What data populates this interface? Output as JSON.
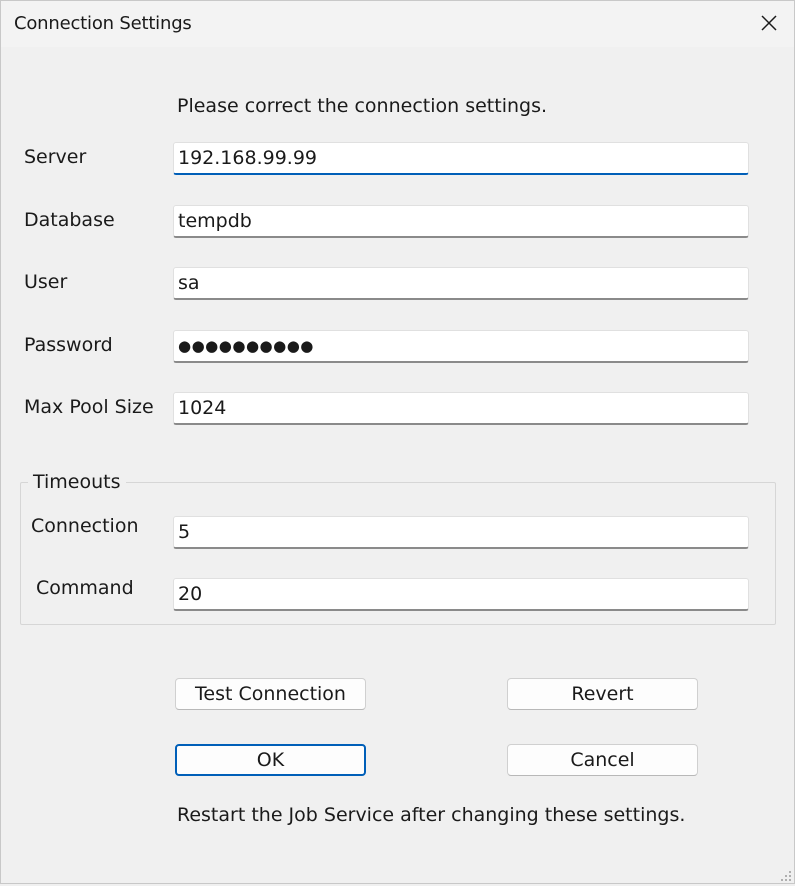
{
  "window": {
    "title": "Connection Settings"
  },
  "instruction": "Please correct the connection settings.",
  "fields": {
    "server": {
      "label": "Server",
      "value": "192.168.99.99"
    },
    "database": {
      "label": "Database",
      "value": "tempdb"
    },
    "user": {
      "label": "User",
      "value": "sa"
    },
    "password": {
      "label": "Password",
      "value": "●●●●●●●●●●"
    },
    "max_pool_size": {
      "label": "Max Pool Size",
      "value": "1024"
    }
  },
  "timeouts": {
    "title": "Timeouts",
    "connection": {
      "label": "Connection",
      "value": "5"
    },
    "command": {
      "label": "Command",
      "value": "20"
    }
  },
  "buttons": {
    "test_connection": "Test Connection",
    "revert": "Revert",
    "ok": "OK",
    "cancel": "Cancel"
  },
  "footer_note": "Restart the Job Service after changing these settings.",
  "icons": {
    "close": "close-icon",
    "resize_grip": "resize-grip-icon"
  },
  "colors": {
    "accent": "#005fb8",
    "background": "#f0f0f0"
  }
}
